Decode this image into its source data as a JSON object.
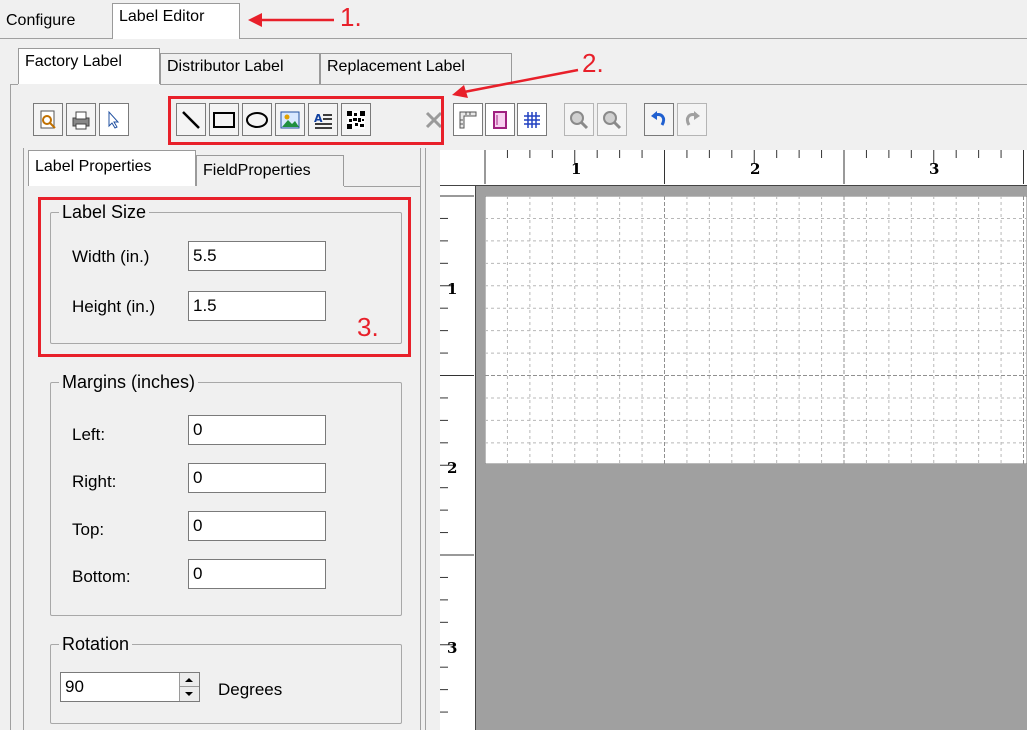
{
  "top_tabs": [
    {
      "label": "Configure"
    },
    {
      "label": "Label Editor"
    }
  ],
  "sub_tabs": [
    {
      "label": "Factory Label"
    },
    {
      "label": "Distributor Label"
    },
    {
      "label": "Replacement Label"
    }
  ],
  "toolbar": {
    "icons": [
      "print-preview-icon",
      "print-icon",
      "pointer-icon",
      "line-tool-icon",
      "rectangle-tool-icon",
      "ellipse-tool-icon",
      "image-tool-icon",
      "text-tool-icon",
      "barcode-tool-icon",
      "delete-icon",
      "ruler-icon",
      "page-icon",
      "grid-icon",
      "zoom-in-icon",
      "zoom-out-icon",
      "undo-icon",
      "redo-icon"
    ]
  },
  "panel_tabs": [
    {
      "label": "Label Properties"
    },
    {
      "label": "FieldProperties"
    }
  ],
  "label_size": {
    "legend": "Label Size",
    "width_label": "Width (in.)",
    "width_value": "5.5",
    "height_label": "Height (in.)",
    "height_value": "1.5"
  },
  "margins": {
    "legend": "Margins (inches)",
    "left_label": "Left:",
    "left_value": "0",
    "right_label": "Right:",
    "right_value": "0",
    "top_label": "Top:",
    "top_value": "0",
    "bottom_label": "Bottom:",
    "bottom_value": "0"
  },
  "rotation": {
    "legend": "Rotation",
    "value": "90",
    "unit": "Degrees"
  },
  "ruler": {
    "h_numbers": [
      "1",
      "2",
      "3"
    ],
    "v_numbers": [
      "1",
      "2",
      "3"
    ]
  },
  "annotations": {
    "a1": "1.",
    "a2": "2.",
    "a3": "3."
  },
  "colors": {
    "annotation_red": "#e8202a",
    "canvas_bg": "#a0a0a0",
    "label_bg": "#ffffff",
    "grid": "#b8b8b8"
  }
}
